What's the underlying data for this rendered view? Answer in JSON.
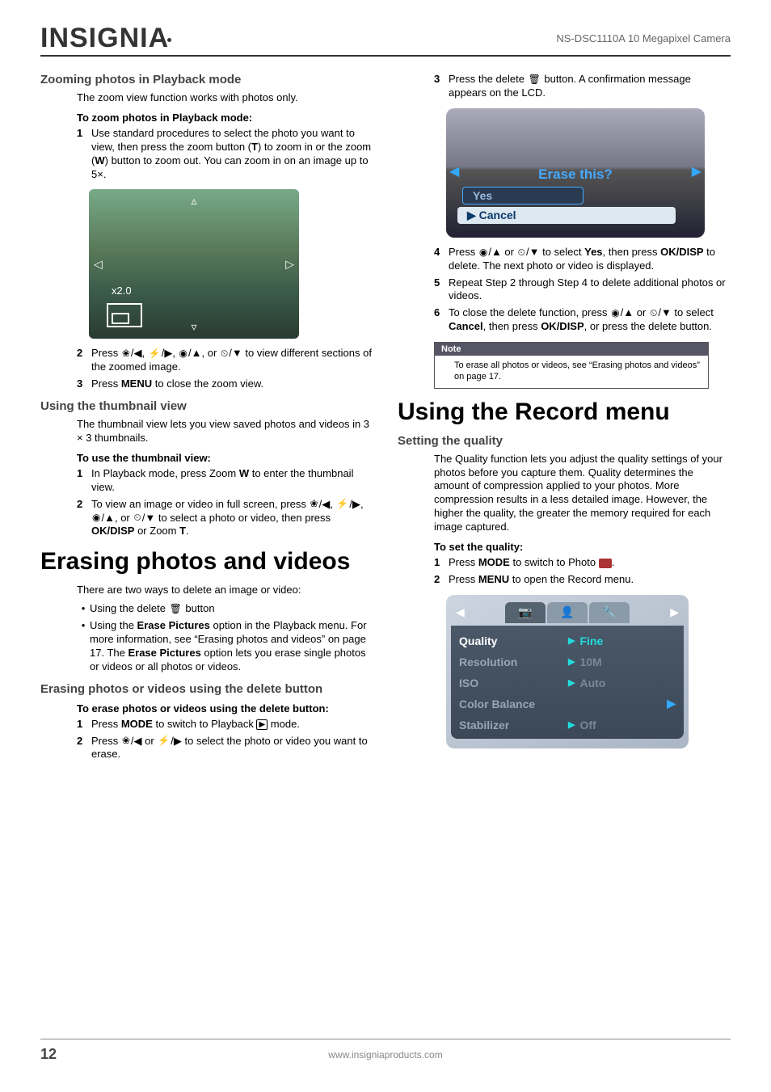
{
  "header": {
    "logo_text": "INSIGNIA",
    "product": "NS-DSC1110A 10 Megapixel Camera"
  },
  "footer": {
    "page": "12",
    "url": "www.insigniaproducts.com"
  },
  "left": {
    "h3_zoom": "Zooming photos in Playback mode",
    "p_zoom_intro": "The zoom view function works with photos only.",
    "lead_zoom": "To zoom photos in Playback mode:",
    "step1_zoom_a": "Use standard procedures to select the photo you want to view, then press the zoom button (",
    "step1_zoom_b": ") to zoom in or the zoom (",
    "step1_zoom_c": ") button to zoom out. You can zoom in on an image up to 5×.",
    "T": "T",
    "W": "W",
    "fig_zoom_label": "x2.0",
    "step2_zoom_a": "Press ",
    "step2_zoom_b": " to view different sections of the zoomed image.",
    "step3_zoom_a": "Press ",
    "step3_zoom_b": " to close the zoom view.",
    "MENU": "MENU",
    "h3_thumb": "Using the thumbnail view",
    "p_thumb_intro": "The thumbnail view lets you view saved photos and videos in 3 × 3 thumbnails.",
    "lead_thumb": "To use the thumbnail view:",
    "step1_thumb_a": "In Playback mode, press Zoom ",
    "step1_thumb_b": " to enter the thumbnail view.",
    "step2_thumb_a": "To view an image or video in full screen, press ",
    "step2_thumb_b": " to select a photo or video, then press ",
    "step2_thumb_c": " or Zoom ",
    "step2_thumb_d": ".",
    "OKDISP": "OK/DISP",
    "h1_erase": "Erasing photos and videos",
    "p_erase_intro": "There are two ways to delete an image or video:",
    "bullet1_a": "Using the delete ",
    "bullet1_b": " button",
    "bullet2_a": "Using the ",
    "bullet2_b": "Erase Pictures",
    "bullet2_c": " option in the Playback menu. For more information, see “Erasing photos and videos” on page 17. The ",
    "bullet2_d": "Erase Pictures",
    "bullet2_e": " option lets you erase single photos or videos or all photos or videos.",
    "h3_erasebtn": "Erasing photos or videos using the delete button",
    "lead_erasebtn": "To erase photos or videos using the delete button:",
    "step1_eb_a": "Press ",
    "step1_eb_b": " to switch to Playback ",
    "step1_eb_c": " mode.",
    "MODE": "MODE",
    "step2_eb_a": "Press ",
    "step2_eb_b": " to select the photo or video you want to erase."
  },
  "right": {
    "step3_a": "Press the delete ",
    "step3_b": " button. A confirmation message appears on the LCD.",
    "fig_erase_prompt": "Erase this?",
    "fig_yes": "Yes",
    "fig_cancel": "Cancel",
    "step4_a": "Press ",
    "step4_b": " to select ",
    "step4_c": ", then press ",
    "step4_d": " to delete. The next photo or video is displayed.",
    "Yes": "Yes",
    "OKDISP": "OK/DISP",
    "step5": "Repeat Step 2 through Step 4 to delete additional photos or videos.",
    "step6_a": "To close the delete function, press ",
    "step6_b": " to select ",
    "step6_c": ", then press ",
    "step6_d": ", or press the delete button.",
    "Cancel": "Cancel",
    "note_header": "Note",
    "note_body": "To erase all photos or videos, see “Erasing photos and videos” on page 17.",
    "h1_record": "Using the Record menu",
    "h3_quality": "Setting the quality",
    "p_quality": "The Quality function lets you adjust the quality settings of your photos before you capture them. Quality determines the amount of compression applied to your photos. More compression results in a less detailed image. However, the higher the quality, the greater the memory required for each image captured.",
    "lead_quality": "To set the quality:",
    "step1_q_a": "Press ",
    "step1_q_b": " to switch to Photo ",
    "step1_q_c": ".",
    "MODE": "MODE",
    "step2_q_a": "Press ",
    "step2_q_b": " to open the Record menu.",
    "MENU": "MENU",
    "menu": {
      "items": [
        {
          "label": "Quality",
          "value": "Fine",
          "active": true,
          "side": false
        },
        {
          "label": "Resolution",
          "value": "10M",
          "active": false,
          "side": false
        },
        {
          "label": "ISO",
          "value": "Auto",
          "active": false,
          "side": false
        },
        {
          "label": "Color Balance",
          "value": "",
          "active": false,
          "side": true
        },
        {
          "label": "Stabilizer",
          "value": "Off",
          "active": false,
          "side": false
        }
      ]
    }
  },
  "nums": {
    "n1": "1",
    "n2": "2",
    "n3": "3",
    "n4": "4",
    "n5": "5",
    "n6": "6"
  },
  "glyphs": {
    "macro": "❀",
    "flash": "⚡",
    "scene": "◉",
    "timer": "⏲",
    "or": " or ",
    "comma": ", ",
    "left": "/◀",
    "right": "/▶",
    "up": "/▲",
    "down": "/▼",
    "trash": "🗑",
    "play": "▶",
    "camera": "📷",
    "tab_portrait": "👤",
    "tab_tools": "🔧"
  }
}
